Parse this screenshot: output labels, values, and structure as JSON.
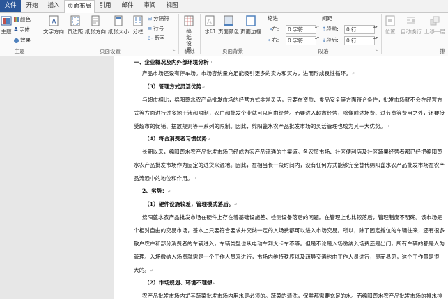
{
  "tabs": [
    "文件",
    "开始",
    "插入",
    "页面布局",
    "引用",
    "邮件",
    "审阅",
    "视图"
  ],
  "ribbon": {
    "theme": {
      "btn": "主题",
      "colors": "颜色",
      "fonts": "字体",
      "effects": "效果",
      "label": "主题"
    },
    "page_setup": {
      "text_dir": "文字方向",
      "margins": "页边距",
      "orientation": "纸张方向",
      "size": "纸张大小",
      "columns": "分栏",
      "breaks": "分隔符",
      "line_numbers": "行号",
      "hyphenation": "断字",
      "label": "页面设置"
    },
    "background": {
      "watermark": "水印",
      "page_color": "页面颜色",
      "page_borders": "页面边框",
      "label": "页面背景"
    },
    "manuscript": {
      "btn": "稿纸设置",
      "label": "稿纸"
    },
    "paragraph": {
      "indent_title": "缩进",
      "spacing_title": "间距",
      "left_label": "左:",
      "left_value": "0 字符",
      "right_label": "右:",
      "right_value": "0 字符",
      "before_label": "段前:",
      "before_value": "0 行",
      "after_label": "段后:",
      "after_value": "0 行",
      "label": "段落"
    },
    "arrange": {
      "position": "位置",
      "wrap": "自动换行",
      "bring_forward": "上移一层",
      "label": "排"
    }
  },
  "document": {
    "lines": [
      "一、企业概况及内外部环境分析",
      "产品市场还设有停车场。市场容纳量充足能吸引更多的卖方和买方，进而形成良性循环。",
      "（3）管理方式灵活优势",
      "与超市相比，绵阳蓖水农产品批发市场的经营方式非常灵活，只要在资质、食品安全等方面符合条件，批发市场就不会在经营方",
      "式等方面进行过多地干涉和限制，农户和批发企业就可以自由经营。而要进入超市经营，除像前述场费、过节费等费用之外，还要接",
      "受超市的促销、摆放规则等一系列的限制。因此，绵阳蓖水农产品批发市场的灵活管理也成为其一大优势。",
      "（4）符合消费者习惯优势",
      "长期以来，绵阳蓖水农产品批发市场已经成为农产品流通的主渠道。各农贸市场、社区便利店及社区蔬果经营者都已经把绵阳蓖",
      "水农产品批发市场作为固定的进货来源地。因此，在相当长一段时间内，没有任何方式能够完全替代绵阳蓖水农产品批发市场在农产",
      "品流通中的地位和作用。",
      "2、劣势：",
      "（1）硬件设施较差，管理模式落后。",
      "绵阳蓖水农产品批发市场在硬件上存在着基础设施差、检测设备落后的问题。在管理上也比较落后，管理制度不明确。该市场是",
      "个相对自由的交易市场，基本上只要符合要求并交纳一定的入场费都可以进入市场交易。所以，除了固定摊位的车辆往来，还有很多",
      "散户农户和部分消费者的车辆进入，车辆类型也从电动车到大卡车不等。但是不论是入场缴纳入场费还是出门，所有车辆的都是人为",
      "管理。入场缴纳入场费就需是一个工作人员来进行，市场内维持秩序以及疏导交通也由工作人员进行，显而易见，这个工作量是很",
      "大的。",
      "（2）市场规划、环境不理想",
      "农产品批发市场内尤其蔬菜批发市场内用水是必须的。蔬菜的清洗，保鲜都需要充足的水。而绵阳蓖水农产品批发市场的排水排"
    ]
  }
}
